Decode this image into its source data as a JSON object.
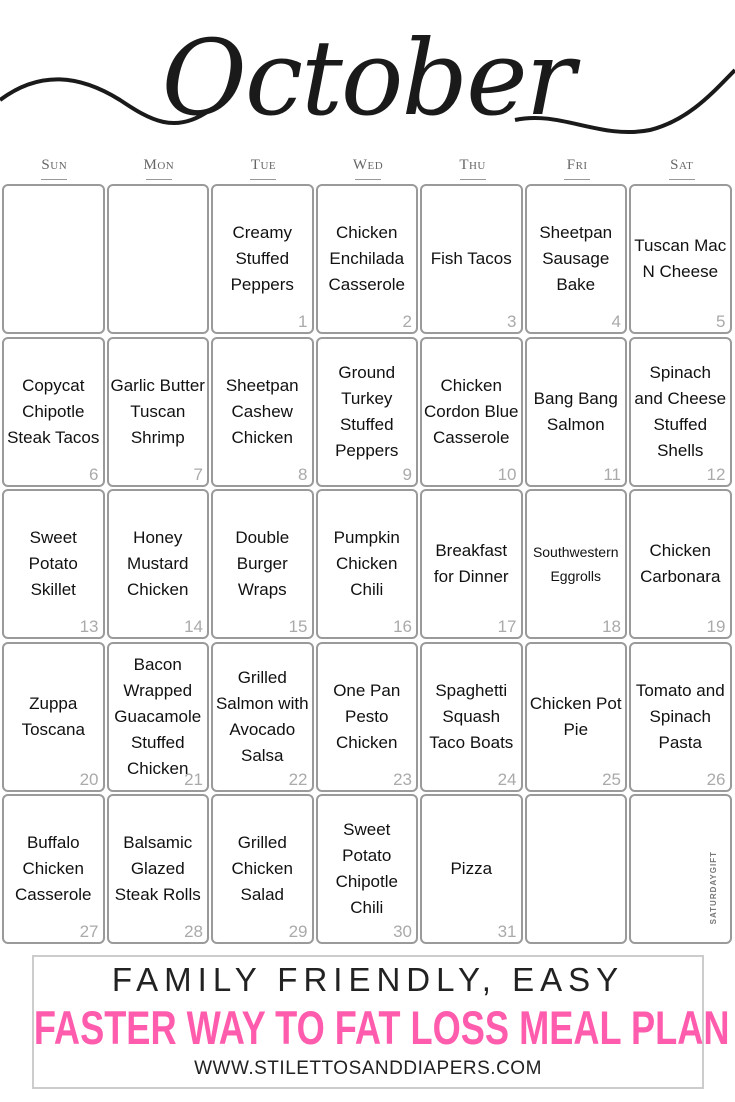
{
  "header": {
    "month_title": "October",
    "days_of_week": [
      "Sun",
      "Mon",
      "Tue",
      "Wed",
      "Thu",
      "Fri",
      "Sat"
    ]
  },
  "calendar": {
    "cells": [
      {
        "day": "",
        "meal": ""
      },
      {
        "day": "",
        "meal": ""
      },
      {
        "day": "1",
        "meal": "Creamy Stuffed Peppers"
      },
      {
        "day": "2",
        "meal": "Chicken Enchilada Casserole"
      },
      {
        "day": "3",
        "meal": "Fish Tacos"
      },
      {
        "day": "4",
        "meal": "Sheetpan Sausage Bake"
      },
      {
        "day": "5",
        "meal": "Tuscan Mac N Cheese"
      },
      {
        "day": "6",
        "meal": "Copycat Chipotle Steak Tacos"
      },
      {
        "day": "7",
        "meal": "Garlic Butter Tuscan Shrimp"
      },
      {
        "day": "8",
        "meal": "Sheetpan Cashew Chicken"
      },
      {
        "day": "9",
        "meal": "Ground Turkey Stuffed Peppers"
      },
      {
        "day": "10",
        "meal": "Chicken Cordon Blue Casserole"
      },
      {
        "day": "11",
        "meal": "Bang Bang Salmon"
      },
      {
        "day": "12",
        "meal": "Spinach and Cheese Stuffed Shells"
      },
      {
        "day": "13",
        "meal": "Sweet Potato Skillet"
      },
      {
        "day": "14",
        "meal": "Honey Mustard Chicken"
      },
      {
        "day": "15",
        "meal": "Double Burger Wraps"
      },
      {
        "day": "16",
        "meal": "Pumpkin Chicken Chili"
      },
      {
        "day": "17",
        "meal": "Breakfast for Dinner"
      },
      {
        "day": "18",
        "meal": "Southwestern Eggrolls"
      },
      {
        "day": "19",
        "meal": "Chicken Carbonara"
      },
      {
        "day": "20",
        "meal": "Zuppa Toscana"
      },
      {
        "day": "21",
        "meal": "Bacon Wrapped Guacamole Stuffed Chicken"
      },
      {
        "day": "22",
        "meal": "Grilled Salmon with Avocado Salsa"
      },
      {
        "day": "23",
        "meal": "One Pan Pesto Chicken"
      },
      {
        "day": "24",
        "meal": "Spaghetti Squash Taco Boats"
      },
      {
        "day": "25",
        "meal": "Chicken Pot Pie"
      },
      {
        "day": "26",
        "meal": "Tomato and Spinach Pasta"
      },
      {
        "day": "27",
        "meal": "Buffalo Chicken Casserole"
      },
      {
        "day": "28",
        "meal": "Balsamic Glazed Steak Rolls"
      },
      {
        "day": "29",
        "meal": "Grilled Chicken Salad"
      },
      {
        "day": "30",
        "meal": "Sweet Potato Chipotle Chili"
      },
      {
        "day": "31",
        "meal": "Pizza"
      },
      {
        "day": "",
        "meal": ""
      },
      {
        "day": "",
        "meal": "",
        "watermark": "SATURDAYGIFT"
      }
    ]
  },
  "footer": {
    "line1": "FAMILY FRIENDLY, EASY",
    "line2": "FASTER WAY TO FAT LOSS MEAL PLAN",
    "line3": "WWW.STILETTOSANDDIAPERS.COM",
    "accent_color": "#ff5cae"
  }
}
